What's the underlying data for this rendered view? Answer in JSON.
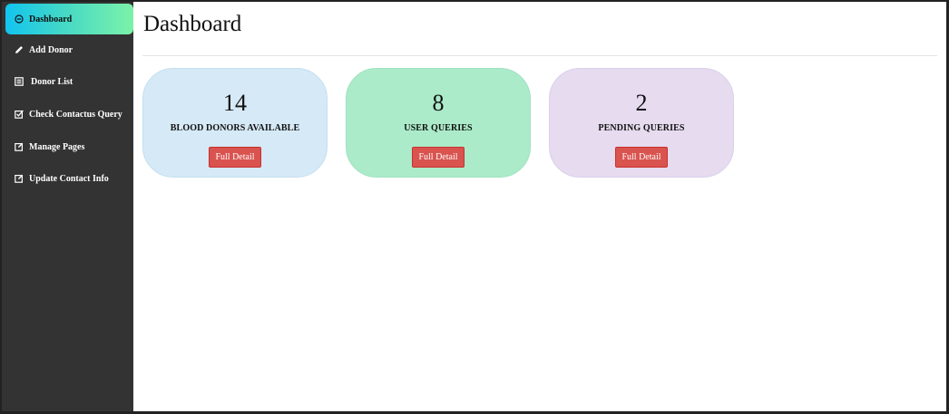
{
  "sidebar": {
    "items": [
      {
        "label": "Dashboard",
        "icon": "dashboard-icon",
        "active": true
      },
      {
        "label": "Add Donor",
        "icon": "pencil-icon",
        "active": false
      },
      {
        "label": "Donor List",
        "icon": "list-icon",
        "active": false
      },
      {
        "label": "Check Contactus Query",
        "icon": "checkbox-icon",
        "active": false
      },
      {
        "label": "Manage Pages",
        "icon": "edit-box-icon",
        "active": false
      },
      {
        "label": "Update Contact Info",
        "icon": "edit-box-icon",
        "active": false
      }
    ]
  },
  "main": {
    "title": "Dashboard",
    "cards": [
      {
        "count": "14",
        "label": "BLOOD DONORS AVAILABLE",
        "button": "Full Detail",
        "color": "#d6e9f6"
      },
      {
        "count": "8",
        "label": "USER QUERIES",
        "button": "Full Detail",
        "color": "#abebc9"
      },
      {
        "count": "2",
        "label": "PENDING QUERIES",
        "button": "Full Detail",
        "color": "#e6dbef"
      }
    ]
  },
  "colors": {
    "sidebar_bg": "#333333",
    "active_gradient_start": "#12c4f0",
    "active_gradient_end": "#7cf2a8",
    "button_red": "#d9534f"
  }
}
